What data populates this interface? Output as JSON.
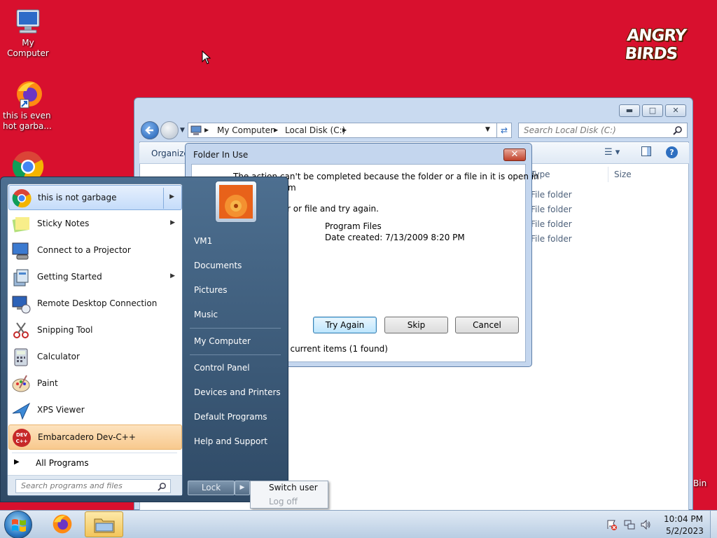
{
  "desktop": {
    "icons": [
      {
        "label": "My Computer"
      },
      {
        "label": "this is even hot garba..."
      }
    ],
    "recycle_bin_partial": "Bin",
    "wallpaper_logo": "ANGRY BIRDS"
  },
  "explorer": {
    "breadcrumb": [
      "My Computer",
      "Local Disk (C:)"
    ],
    "search_placeholder": "Search Local Disk (C:)",
    "toolbar_organize": "Organize",
    "columns": {
      "type": "Type",
      "size": "Size"
    },
    "rows": [
      "File folder",
      "File folder",
      "File folder",
      "File folder"
    ],
    "status_items": "ll current items (1 found)"
  },
  "dialog": {
    "title": "Folder In Use",
    "message_line1": "The action can't be completed because the folder or a file in it is open in",
    "message_line2": "m",
    "instruction": "r or file and try again.",
    "item_name": "Program Files",
    "item_date": "Date created: 7/13/2009 8:20 PM",
    "buttons": {
      "try_again": "Try Again",
      "skip": "Skip",
      "cancel": "Cancel"
    }
  },
  "start_menu": {
    "left_items": [
      {
        "label": "this is not garbage",
        "has_arrow": true
      },
      {
        "label": "Sticky Notes",
        "has_arrow": true
      },
      {
        "label": "Connect to a Projector",
        "has_arrow": false
      },
      {
        "label": "Getting Started",
        "has_arrow": true
      },
      {
        "label": "Remote Desktop Connection",
        "has_arrow": false
      },
      {
        "label": "Snipping Tool",
        "has_arrow": false
      },
      {
        "label": "Calculator",
        "has_arrow": false
      },
      {
        "label": "Paint",
        "has_arrow": false
      },
      {
        "label": "XPS Viewer",
        "has_arrow": false
      },
      {
        "label": "Embarcadero Dev-C++",
        "has_arrow": false
      }
    ],
    "all_programs": "All Programs",
    "search_placeholder": "Search programs and files",
    "right_items": [
      "VM1",
      "Documents",
      "Pictures",
      "Music",
      "My Computer",
      "Control Panel",
      "Devices and Printers",
      "Default Programs",
      "Help and Support"
    ],
    "lock_label": "Lock",
    "power_flyout": {
      "switch_user": "Switch user",
      "log_off": "Log off"
    }
  },
  "taskbar": {
    "clock_time": "10:04 PM",
    "clock_date": "5/2/2023"
  },
  "colors": {
    "wallpaper": "#d8102e",
    "highlight": "#cfe2fb",
    "devcpp_highlight": "#fbd6a6"
  }
}
